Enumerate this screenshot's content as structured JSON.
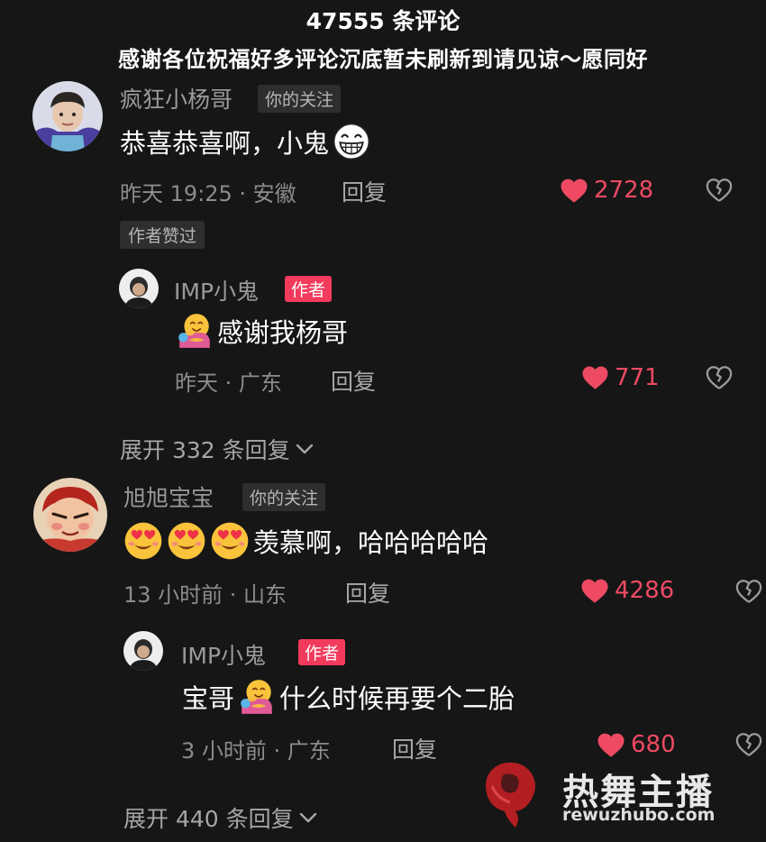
{
  "header": {
    "title": "47555 条评论",
    "subtitle": "感谢各位祝福好多评论沉底暂未刷新到请见谅～愿同好"
  },
  "comments": [
    {
      "user": "疯狂小杨哥",
      "tag": "你的关注",
      "text": "恭喜恭喜啊，小鬼",
      "emojis": [
        "grin-emoji"
      ],
      "meta": "昨天 19:25 · 安徽",
      "reply_label": "回复",
      "likes": "2728",
      "badge": "作者赞过",
      "reply": {
        "user": "IMP小鬼",
        "tag": "作者",
        "text_after": "感谢我杨哥",
        "meta": "昨天 · 广东",
        "reply_label": "回复",
        "likes": "771"
      },
      "expand_label": "展开 332 条回复"
    },
    {
      "user": "旭旭宝宝",
      "tag": "你的关注",
      "text": "羡慕啊，哈哈哈哈哈",
      "emojis": [
        "heart-eyes-emoji",
        "heart-eyes-emoji",
        "heart-eyes-emoji"
      ],
      "meta": "13 小时前 · 山东",
      "reply_label": "回复",
      "likes": "4286",
      "reply": {
        "user": "IMP小鬼",
        "tag": "作者",
        "text_before": "宝哥",
        "text_after": "什么时候再要个二胎",
        "meta": "3 小时前 · 广东",
        "reply_label": "回复",
        "likes": "680"
      },
      "expand_label": "展开 440 条回复"
    }
  ],
  "watermark": {
    "title": "热舞主播",
    "url": "rewuzhubo.com"
  },
  "colors": {
    "background": "#161616",
    "like_red": "#ee4a63",
    "author_tag": "#f23a5c"
  }
}
